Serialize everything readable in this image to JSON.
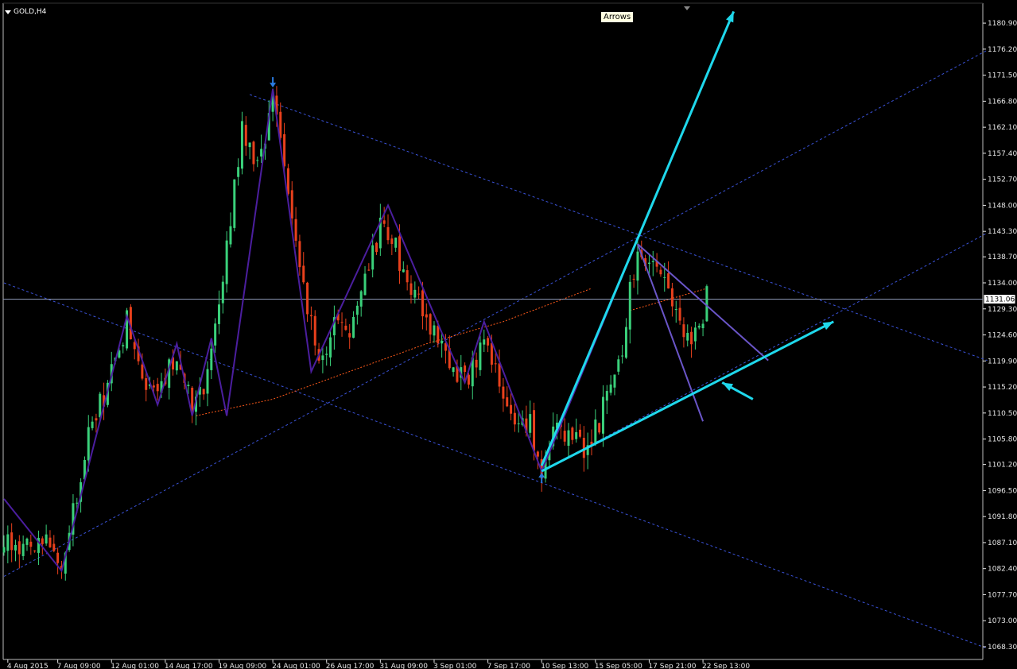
{
  "window": {
    "symbol_title": "GOLD,H4",
    "tooltip": "Arrows"
  },
  "colors": {
    "background": "#000000",
    "bull": "#3ad07a",
    "bear": "#e8401c",
    "zigzag": "#4b1e9e",
    "channel": "#3a52d8",
    "arrow": "#1fd8ec",
    "curve": "#ff5a1a",
    "triangle": "#6a55c8",
    "hline": "#8c96b4",
    "pivot_arrow": "#2a7be0",
    "axis": "#e6e6e6"
  },
  "chart_data": {
    "type": "candlestick",
    "symbol": "GOLD",
    "timeframe": "H4",
    "ylim": [
      1066.0,
      1184.5
    ],
    "y_ticks": [
      1180.9,
      1176.2,
      1171.5,
      1166.8,
      1162.1,
      1157.4,
      1152.7,
      1148.0,
      1143.3,
      1138.7,
      1134.0,
      1129.3,
      1124.6,
      1119.9,
      1115.2,
      1110.5,
      1105.8,
      1101.2,
      1096.5,
      1091.8,
      1087.1,
      1082.4,
      1077.7,
      1073.0,
      1068.3
    ],
    "x_ticks": [
      {
        "bar": 1,
        "label": "4 Aug 2015"
      },
      {
        "bar": 14,
        "label": "7 Aug 09:00"
      },
      {
        "bar": 28,
        "label": "12 Aug 01:00"
      },
      {
        "bar": 42,
        "label": "14 Aug 17:00"
      },
      {
        "bar": 56,
        "label": "19 Aug 09:00"
      },
      {
        "bar": 70,
        "label": "24 Aug 01:00"
      },
      {
        "bar": 84,
        "label": "26 Aug 17:00"
      },
      {
        "bar": 98,
        "label": "31 Aug 09:00"
      },
      {
        "bar": 112,
        "label": "3 Sep 01:00"
      },
      {
        "bar": 126,
        "label": "7 Sep 17:00"
      },
      {
        "bar": 140,
        "label": "10 Sep 13:00"
      },
      {
        "bar": 154,
        "label": "15 Sep 05:00"
      },
      {
        "bar": 168,
        "label": "17 Sep 21:00"
      },
      {
        "bar": 182,
        "label": "22 Sep 13:00"
      }
    ],
    "current_price": 1131.06,
    "current_price_label": "1131.06",
    "anchors": [
      {
        "bar": 0,
        "price": 1088
      },
      {
        "bar": 5,
        "price": 1085
      },
      {
        "bar": 10,
        "price": 1089
      },
      {
        "bar": 15,
        "price": 1083
      },
      {
        "bar": 22,
        "price": 1107
      },
      {
        "bar": 26,
        "price": 1114
      },
      {
        "bar": 32,
        "price": 1127
      },
      {
        "bar": 36,
        "price": 1117
      },
      {
        "bar": 40,
        "price": 1113
      },
      {
        "bar": 45,
        "price": 1122
      },
      {
        "bar": 50,
        "price": 1111
      },
      {
        "bar": 54,
        "price": 1121
      },
      {
        "bar": 58,
        "price": 1140
      },
      {
        "bar": 62,
        "price": 1162
      },
      {
        "bar": 66,
        "price": 1155
      },
      {
        "bar": 70,
        "price": 1166
      },
      {
        "bar": 74,
        "price": 1152
      },
      {
        "bar": 78,
        "price": 1135
      },
      {
        "bar": 82,
        "price": 1118
      },
      {
        "bar": 86,
        "price": 1128
      },
      {
        "bar": 90,
        "price": 1123
      },
      {
        "bar": 94,
        "price": 1136
      },
      {
        "bar": 99,
        "price": 1146
      },
      {
        "bar": 103,
        "price": 1138
      },
      {
        "bar": 107,
        "price": 1133
      },
      {
        "bar": 112,
        "price": 1125
      },
      {
        "bar": 116,
        "price": 1120
      },
      {
        "bar": 121,
        "price": 1116
      },
      {
        "bar": 125,
        "price": 1126
      },
      {
        "bar": 129,
        "price": 1116
      },
      {
        "bar": 133,
        "price": 1106
      },
      {
        "bar": 137,
        "price": 1109
      },
      {
        "bar": 140,
        "price": 1100
      },
      {
        "bar": 143,
        "price": 1108
      },
      {
        "bar": 147,
        "price": 1106
      },
      {
        "bar": 151,
        "price": 1104
      },
      {
        "bar": 155,
        "price": 1108
      },
      {
        "bar": 158,
        "price": 1118
      },
      {
        "bar": 161,
        "price": 1123
      },
      {
        "bar": 165,
        "price": 1141
      },
      {
        "bar": 169,
        "price": 1136
      },
      {
        "bar": 173,
        "price": 1133
      },
      {
        "bar": 176,
        "price": 1125
      },
      {
        "bar": 179,
        "price": 1123
      },
      {
        "bar": 182,
        "price": 1127
      },
      {
        "bar": 183,
        "price": 1131
      }
    ],
    "zigzag": [
      {
        "bar": 0,
        "price": 1095
      },
      {
        "bar": 15,
        "price": 1082
      },
      {
        "bar": 32,
        "price": 1128
      },
      {
        "bar": 40,
        "price": 1112
      },
      {
        "bar": 45,
        "price": 1123
      },
      {
        "bar": 49,
        "price": 1110
      },
      {
        "bar": 54,
        "price": 1124
      },
      {
        "bar": 58,
        "price": 1110
      },
      {
        "bar": 70,
        "price": 1169
      },
      {
        "bar": 80,
        "price": 1118
      },
      {
        "bar": 100,
        "price": 1148
      },
      {
        "bar": 114,
        "price": 1125
      },
      {
        "bar": 120,
        "price": 1116
      },
      {
        "bar": 125,
        "price": 1127
      },
      {
        "bar": 140,
        "price": 1100
      },
      {
        "bar": 165,
        "price": 1142
      }
    ],
    "channel_lines": [
      {
        "from": {
          "bar": 64,
          "price": 1168
        },
        "to": {
          "bar": 256,
          "price": 1120
        }
      },
      {
        "from": {
          "bar": 0,
          "price": 1134
        },
        "to": {
          "bar": 256,
          "price": 1068
        }
      },
      {
        "from": {
          "bar": 0,
          "price": 1081
        },
        "to": {
          "bar": 256,
          "price": 1176
        }
      },
      {
        "from": {
          "bar": 140,
          "price": 1100
        },
        "to": {
          "bar": 256,
          "price": 1143
        }
      }
    ],
    "arrows": [
      {
        "from": {
          "bar": 140,
          "price": 1101
        },
        "to": {
          "bar": 190,
          "price": 1183
        }
      },
      {
        "from": {
          "bar": 140,
          "price": 1100
        },
        "to": {
          "bar": 216,
          "price": 1127
        }
      },
      {
        "from": {
          "bar": 195,
          "price": 1113
        },
        "to": {
          "bar": 187,
          "price": 1116
        }
      }
    ],
    "triangle_lines": [
      {
        "from": {
          "bar": 165,
          "price": 1141
        },
        "to": {
          "bar": 199,
          "price": 1120
        }
      },
      {
        "from": {
          "bar": 165,
          "price": 1141
        },
        "to": {
          "bar": 182,
          "price": 1109
        }
      }
    ],
    "curve": [
      {
        "bar": 50,
        "price": 1110
      },
      {
        "bar": 70,
        "price": 1113
      },
      {
        "bar": 90,
        "price": 1118
      },
      {
        "bar": 110,
        "price": 1123
      },
      {
        "bar": 130,
        "price": 1127
      },
      {
        "bar": 153,
        "price": 1133
      }
    ],
    "dashed_segment": {
      "from": {
        "bar": 163,
        "price": 1129
      },
      "to": {
        "bar": 183,
        "price": 1133
      }
    },
    "pivot_markers": [
      {
        "bar": 70,
        "price": 1170,
        "dir": "down"
      },
      {
        "bar": 140,
        "price": 1099,
        "dir": "up"
      }
    ]
  }
}
